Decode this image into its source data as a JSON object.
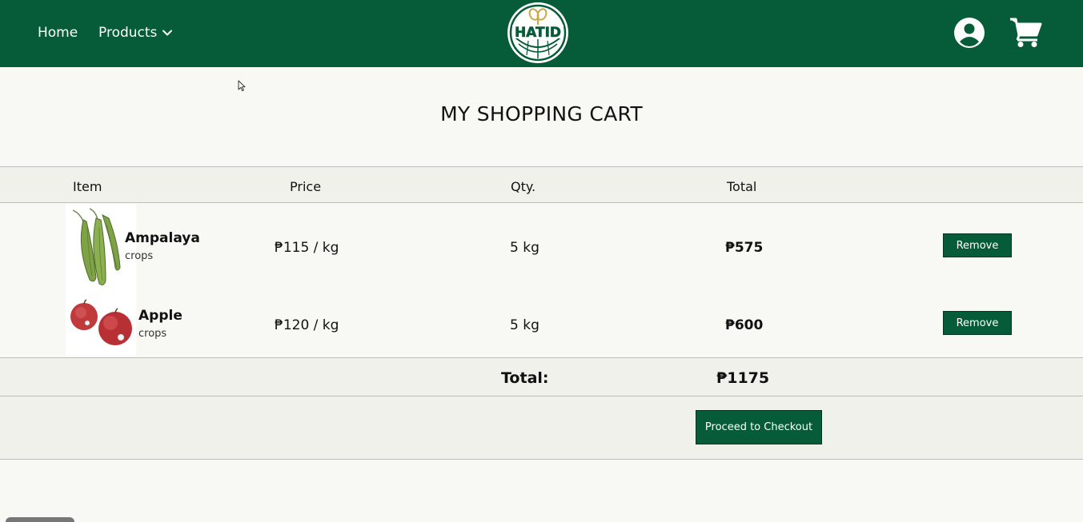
{
  "nav": {
    "home_label": "Home",
    "products_label": "Products",
    "logo_text": "HATID",
    "brand_color": "#065c38",
    "icons": [
      "chevron-down-icon",
      "user-account-icon",
      "shopping-cart-icon"
    ]
  },
  "page": {
    "title": "MY SHOPPING CART"
  },
  "cart": {
    "columns": [
      "Item",
      "Price",
      "Qty.",
      "Total"
    ],
    "items": [
      {
        "name": "Ampalaya",
        "category": "crops",
        "price": "₱115 / kg",
        "qty": "5 kg",
        "total": "₱575",
        "remove_label": "Remove"
      },
      {
        "name": "Apple",
        "category": "crops",
        "price": "₱120 / kg",
        "qty": "5 kg",
        "total": "₱600",
        "remove_label": "Remove"
      }
    ],
    "total_label": "Total:",
    "total_value": "₱1175",
    "checkout_label": "Proceed to Checkout"
  }
}
